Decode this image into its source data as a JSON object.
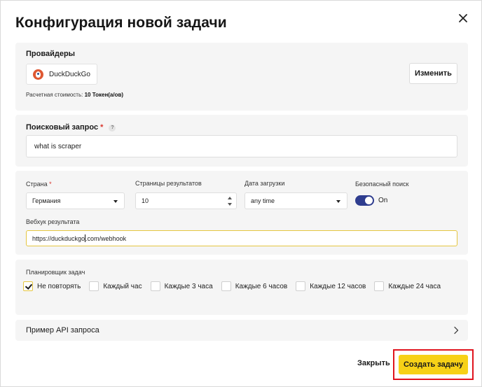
{
  "modal": {
    "title": "Конфигурация новой задачи"
  },
  "providers": {
    "label": "Провайдеры",
    "selected": "DuckDuckGo",
    "change_label": "Изменить",
    "cost_prefix": "Расчетная стоимость: ",
    "cost_value": "10 Токен(а/ов)"
  },
  "query": {
    "label": "Поисковый запрос",
    "required_mark": "*",
    "help_icon": "?",
    "value": "what is scraper"
  },
  "settings": {
    "country_label": "Страна",
    "country_required": "*",
    "country_value": "Германия",
    "pages_label": "Страницы результатов",
    "pages_value": "10",
    "date_label": "Дата загрузки",
    "date_value": "any time",
    "safe_label": "Безопасный поиск",
    "safe_state": "On",
    "webhook_label": "Вебхук результата",
    "webhook_before_caret": "https://duckduckgo",
    "webhook_after_caret": ".com/webhook"
  },
  "scheduler": {
    "label": "Планировщик задач",
    "options": [
      {
        "label": "Не повторять",
        "checked": true
      },
      {
        "label": "Каждый час",
        "checked": false
      },
      {
        "label": "Каждые 3 часа",
        "checked": false
      },
      {
        "label": "Каждые 6 часов",
        "checked": false
      },
      {
        "label": "Каждые 12 часов",
        "checked": false
      },
      {
        "label": "Каждые 24 часа",
        "checked": false
      }
    ]
  },
  "api_example": {
    "label": "Пример API запроса"
  },
  "footer": {
    "close_label": "Закрыть",
    "create_label": "Создать задачу"
  },
  "colors": {
    "accent_yellow": "#f7d117",
    "toggle_on": "#2f3d8f",
    "required_red": "#d9342b",
    "highlight_red": "#e0141e",
    "focus_border": "#e5c640"
  },
  "icons": {
    "close": "close-icon",
    "provider_logo": "duckduckgo-logo-icon",
    "chevron": "chevron-right-icon",
    "select_arrow": "chevron-down-icon"
  }
}
